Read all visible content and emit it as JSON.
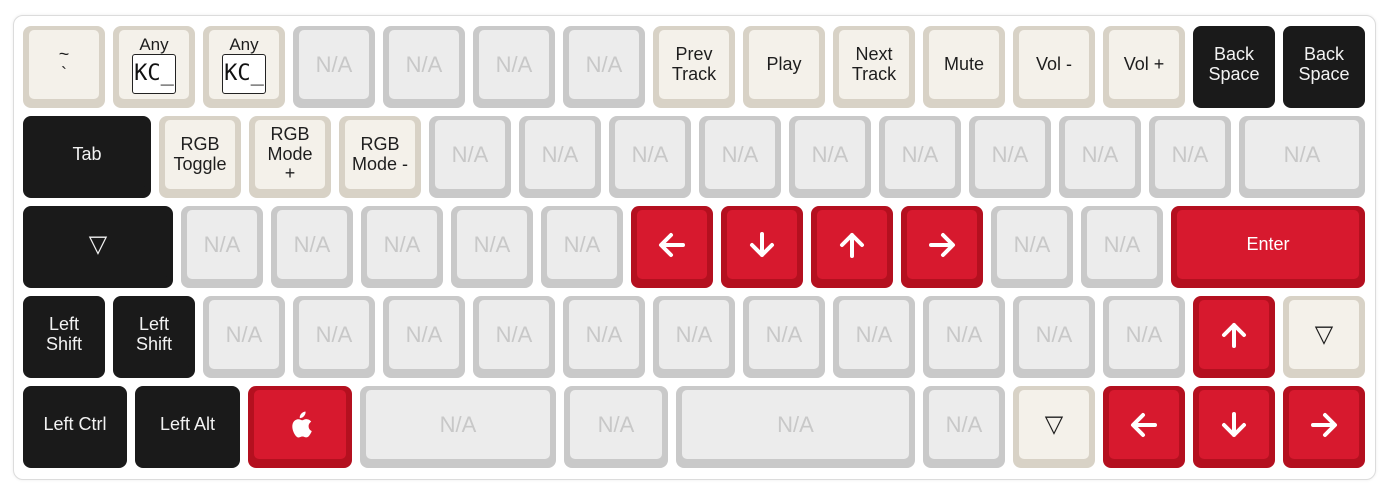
{
  "keys": {
    "grave": [
      "~",
      "`"
    ],
    "any1": {
      "label": "Any",
      "code": "KC_"
    },
    "any2": {
      "label": "Any",
      "code": "KC_"
    },
    "na": "N/A",
    "prev_track": [
      "Prev",
      "Track"
    ],
    "play": "Play",
    "next_track": [
      "Next",
      "Track"
    ],
    "mute": "Mute",
    "vol_down": "Vol -",
    "vol_up": "Vol +",
    "backspace1": [
      "Back",
      "Space"
    ],
    "backspace2": [
      "Back",
      "Space"
    ],
    "tab": "Tab",
    "rgb_toggle": [
      "RGB",
      "Toggle"
    ],
    "rgb_mode_plus": [
      "RGB",
      "Mode",
      "+"
    ],
    "rgb_mode_minus": [
      "RGB",
      "Mode -"
    ],
    "layer_key": "▽",
    "enter": "Enter",
    "left_shift1": [
      "Left",
      "Shift"
    ],
    "left_shift2": [
      "Left",
      "Shift"
    ],
    "left_ctrl": "Left Ctrl",
    "left_alt": "Left Alt"
  },
  "colors": {
    "accent_red": "#d7192e",
    "black": "#1a1a1a",
    "cream": "#f4f1ea",
    "na_grey": "#ececec"
  },
  "icons": {
    "arrow_left": "arrow-left-icon",
    "arrow_down": "arrow-down-icon",
    "arrow_up": "arrow-up-icon",
    "arrow_right": "arrow-right-icon",
    "apple": "apple-logo-icon"
  }
}
